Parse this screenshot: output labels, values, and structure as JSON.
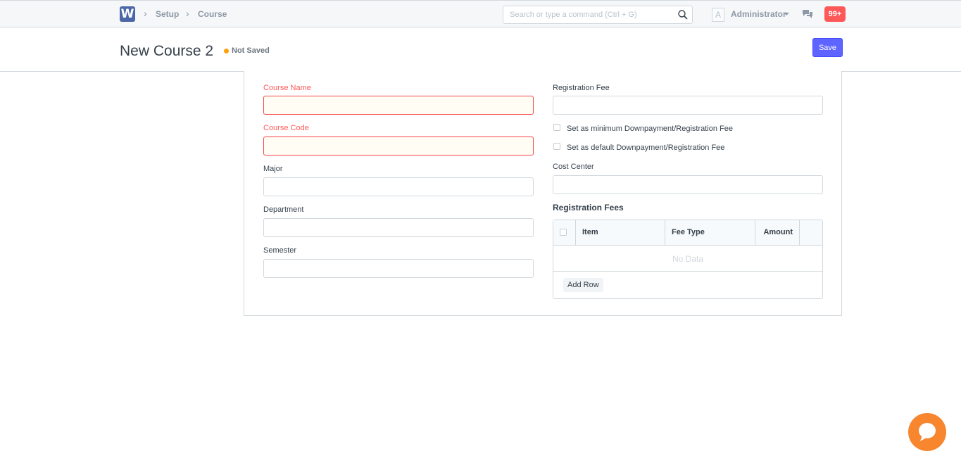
{
  "nav": {
    "logo": "W",
    "breadcrumbs": [
      "Setup",
      "Course"
    ],
    "search_placeholder": "Search or type a command (Ctrl + G)",
    "avatar_initial": "A",
    "user_name": "Administrator",
    "notifications": "99+"
  },
  "page": {
    "title": "New Course 2",
    "status": "Not Saved",
    "save_label": "Save"
  },
  "form": {
    "course_name_label": "Course Name",
    "course_code_label": "Course Code",
    "major_label": "Major",
    "department_label": "Department",
    "semester_label": "Semester",
    "registration_fee_label": "Registration Fee",
    "min_downpayment_label": "Set as minimum Downpayment/Registration Fee",
    "default_downpayment_label": "Set as default Downpayment/Registration Fee",
    "cost_center_label": "Cost Center",
    "registration_fees_title": "Registration Fees",
    "table": {
      "columns": [
        "Item",
        "Fee Type",
        "Amount"
      ],
      "empty_text": "No Data",
      "add_row_label": "Add Row"
    }
  },
  "colors": {
    "primary": "#5e64ff",
    "required": "#ff5858",
    "status_dot": "#ffa00a",
    "notification": "#ff5858",
    "chat_bubble": "#f7862e"
  }
}
